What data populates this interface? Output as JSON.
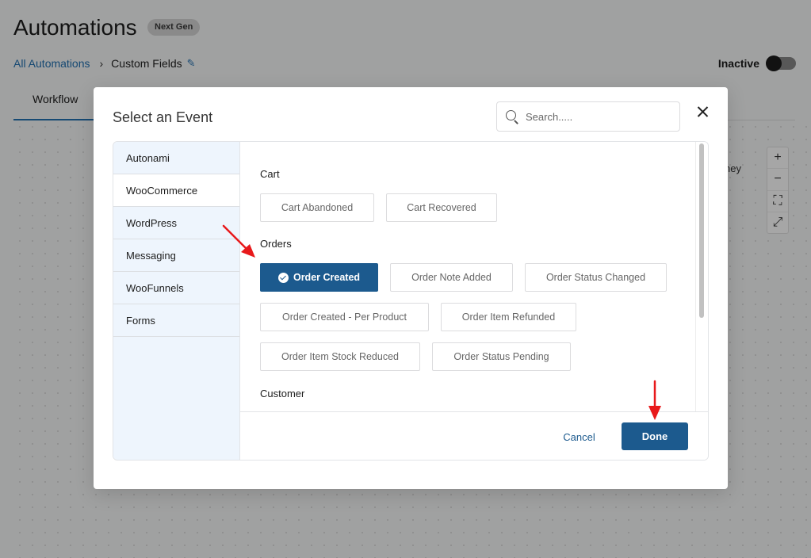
{
  "page": {
    "title": "Automations",
    "badge": "Next Gen",
    "breadcrumb": {
      "root": "All Automations",
      "separator": "›",
      "current": "Custom Fields"
    },
    "status": {
      "label": "Inactive",
      "active": false
    },
    "tabs": [
      {
        "label": "Workflow",
        "active": true
      }
    ],
    "canvas_node_fragment": "ney",
    "zoom_controls": [
      {
        "icon": "zoom-in-icon",
        "glyph": "+"
      },
      {
        "icon": "zoom-out-icon",
        "glyph": "−"
      },
      {
        "icon": "fit-screen-icon",
        "glyph": "⛶"
      },
      {
        "icon": "fullscreen-icon",
        "glyph": "⤢"
      }
    ]
  },
  "modal": {
    "title": "Select an Event",
    "search": {
      "placeholder": "Search.....",
      "value": ""
    },
    "categories": [
      {
        "label": "Autonami",
        "active": false
      },
      {
        "label": "WooCommerce",
        "active": true
      },
      {
        "label": "WordPress",
        "active": false
      },
      {
        "label": "Messaging",
        "active": false
      },
      {
        "label": "WooFunnels",
        "active": false
      },
      {
        "label": "Forms",
        "active": false
      }
    ],
    "groups": {
      "cart": {
        "label": "Cart",
        "events": [
          {
            "label": "Cart Abandoned"
          },
          {
            "label": "Cart Recovered"
          }
        ]
      },
      "orders": {
        "label": "Orders",
        "events": [
          {
            "label": "Order Created",
            "selected": true
          },
          {
            "label": "Order Note Added"
          },
          {
            "label": "Order Status Changed"
          },
          {
            "label": "Order Created - Per Product"
          },
          {
            "label": "Order Item Refunded"
          },
          {
            "label": "Order Item Stock Reduced"
          },
          {
            "label": "Order Status Pending"
          }
        ]
      },
      "customer": {
        "label": "Customer"
      }
    },
    "footer": {
      "cancel_label": "Cancel",
      "done_label": "Done"
    }
  },
  "colors": {
    "primary": "#1c5a8e",
    "link": "#2271b1",
    "sidebar_bg": "#eef5fd",
    "annotation_arrow": "#e8191b"
  }
}
